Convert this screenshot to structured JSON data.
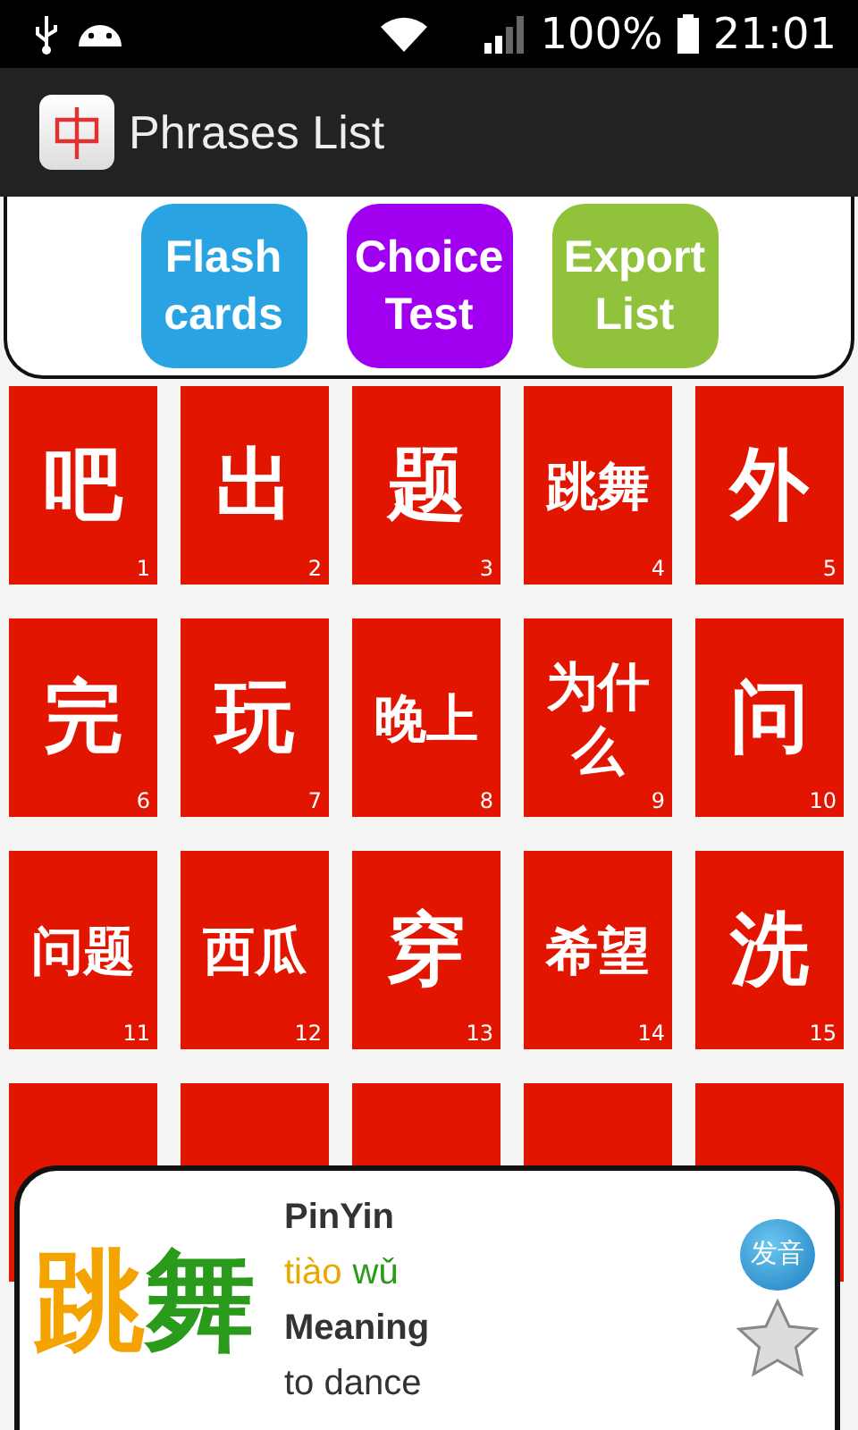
{
  "status_bar": {
    "battery": "100%",
    "time": "21:01"
  },
  "app_bar": {
    "title": "Phrases List"
  },
  "mode_buttons": [
    {
      "label": "Flash cards",
      "color": "#29a3e2"
    },
    {
      "label": "Choice Test",
      "color": "#a100f0"
    },
    {
      "label": "Export List",
      "color": "#90c23c"
    }
  ],
  "tiles": [
    {
      "kind": "phrase",
      "text": "吧",
      "number": "1"
    },
    {
      "kind": "phrase",
      "text": "出",
      "number": "2"
    },
    {
      "kind": "phrase",
      "text": "题",
      "number": "3"
    },
    {
      "kind": "phrase",
      "text": "跳舞",
      "number": "4"
    },
    {
      "kind": "phrase",
      "text": "外",
      "number": "5"
    },
    {
      "kind": "phrase",
      "text": "完",
      "number": "6"
    },
    {
      "kind": "phrase",
      "text": "玩",
      "number": "7"
    },
    {
      "kind": "phrase",
      "text": "晚上",
      "number": "8"
    },
    {
      "kind": "phrase",
      "text": "为什么",
      "number": "9"
    },
    {
      "kind": "phrase",
      "text": "问",
      "number": "10"
    },
    {
      "kind": "phrase",
      "text": "问题",
      "number": "11"
    },
    {
      "kind": "phrase",
      "text": "西瓜",
      "number": "12"
    },
    {
      "kind": "phrase",
      "text": "穿",
      "number": "13"
    },
    {
      "kind": "phrase",
      "text": "希望",
      "number": "14"
    },
    {
      "kind": "phrase",
      "text": "洗",
      "number": "15"
    },
    {
      "kind": "covered"
    },
    {
      "kind": "covered"
    },
    {
      "kind": "covered"
    },
    {
      "kind": "covered"
    },
    {
      "kind": "covered"
    }
  ],
  "detail": {
    "characters": [
      {
        "text": "跳",
        "color": "#f5a300"
      },
      {
        "text": "舞",
        "color": "#2a9a1a"
      }
    ],
    "pinyin_label": "PinYin",
    "pinyin": [
      {
        "text": "tiào",
        "color": "#e8a800"
      },
      {
        "text": "wǔ",
        "color": "#2a9a1a"
      }
    ],
    "meaning_label": "Meaning",
    "meaning": "to dance",
    "sound_button": "发音",
    "favorite": false
  }
}
